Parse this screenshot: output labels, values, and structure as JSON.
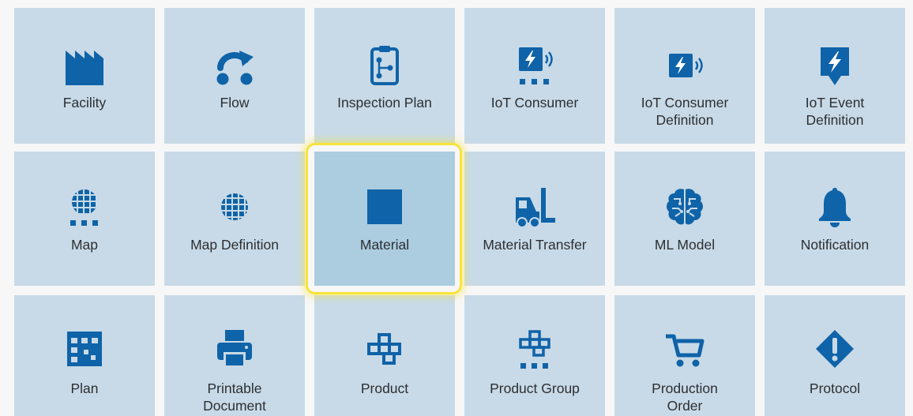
{
  "tiles": [
    {
      "label": "Facility",
      "icon": "factory-icon"
    },
    {
      "label": "Flow",
      "icon": "flow-icon"
    },
    {
      "label": "Inspection Plan",
      "icon": "clipboard-flow-icon"
    },
    {
      "label": "IoT Consumer",
      "icon": "iot-consumer-icon"
    },
    {
      "label": "IoT Consumer\nDefinition",
      "icon": "iot-consumer-definition-icon"
    },
    {
      "label": "IoT Event\nDefinition",
      "icon": "iot-event-icon"
    },
    {
      "label": "Map",
      "icon": "map-icon"
    },
    {
      "label": "Map Definition",
      "icon": "map-definition-icon"
    },
    {
      "label": "Material",
      "icon": "material-square-icon"
    },
    {
      "label": "Material Transfer",
      "icon": "forklift-icon"
    },
    {
      "label": "ML Model",
      "icon": "brain-icon"
    },
    {
      "label": "Notification",
      "icon": "bell-icon"
    },
    {
      "label": "Plan",
      "icon": "plan-grid-icon"
    },
    {
      "label": "Printable\nDocument",
      "icon": "printer-icon"
    },
    {
      "label": "Product",
      "icon": "product-icon"
    },
    {
      "label": "Product Group",
      "icon": "product-group-icon"
    },
    {
      "label": "Production\nOrder",
      "icon": "cart-icon"
    },
    {
      "label": "Protocol",
      "icon": "diamond-exclamation-icon"
    }
  ],
  "selected": "Material",
  "colors": {
    "tile": "#c8dae7",
    "tile_selected": "#acccdf",
    "icon": "#0f63a8",
    "highlight": "#f7e43a",
    "text": "#2c2f33"
  }
}
